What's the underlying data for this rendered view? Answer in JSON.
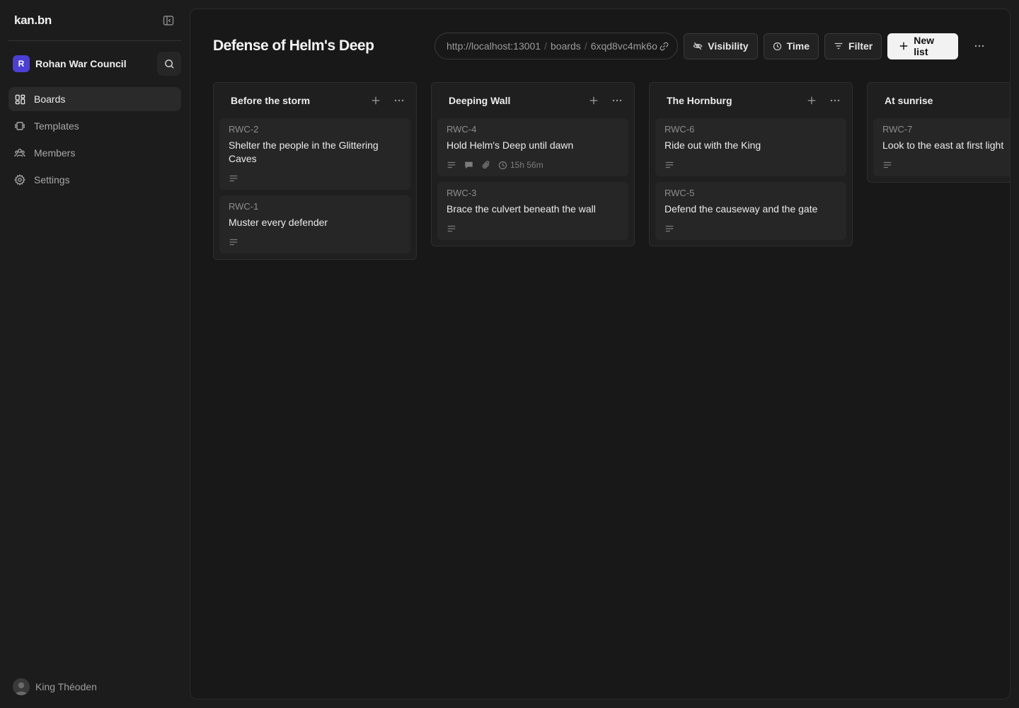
{
  "sidebar": {
    "brand": "kan.bn",
    "workspace": {
      "initial": "R",
      "name": "Rohan War Council",
      "color": "#4b3fd6"
    },
    "nav": [
      {
        "label": "Boards",
        "icon": "boards-icon",
        "active": true
      },
      {
        "label": "Templates",
        "icon": "templates-icon",
        "active": false
      },
      {
        "label": "Members",
        "icon": "members-icon",
        "active": false
      },
      {
        "label": "Settings",
        "icon": "settings-icon",
        "active": false
      }
    ],
    "user": {
      "name": "King Théoden"
    }
  },
  "header": {
    "title": "Defense of Helm's Deep",
    "url": {
      "host": "http://localhost:13001",
      "segment": "boards",
      "id": "6xqd8vc4mk6o"
    },
    "buttons": {
      "visibility": "Visibility",
      "time": "Time",
      "filter": "Filter",
      "new_list": "New list"
    }
  },
  "lists": [
    {
      "title": "Before the storm",
      "cards": [
        {
          "id": "RWC-2",
          "title": "Shelter the people in the Glittering Caves"
        },
        {
          "id": "RWC-1",
          "title": "Muster every defender"
        }
      ]
    },
    {
      "title": "Deeping Wall",
      "cards": [
        {
          "id": "RWC-4",
          "title": "Hold Helm's Deep until dawn",
          "time": "15h 56m"
        },
        {
          "id": "RWC-3",
          "title": "Brace the culvert beneath the wall"
        }
      ]
    },
    {
      "title": "The Hornburg",
      "cards": [
        {
          "id": "RWC-6",
          "title": "Ride out with the King"
        },
        {
          "id": "RWC-5",
          "title": "Defend the causeway and the gate"
        }
      ]
    },
    {
      "title": "At sunrise",
      "cards": [
        {
          "id": "RWC-7",
          "title": "Look to the east at first light"
        }
      ]
    }
  ]
}
